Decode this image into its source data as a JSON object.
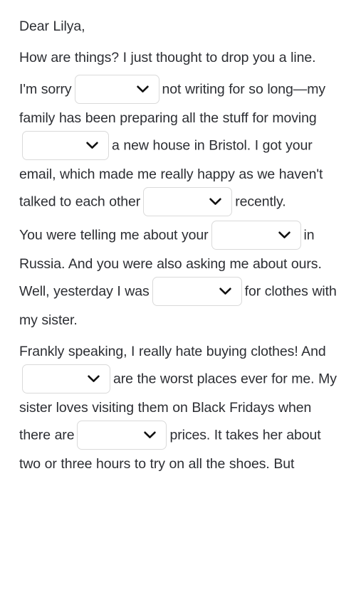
{
  "document": {
    "type": "fill-in-the-blank-letter",
    "background_color": "#ffffff",
    "text_color": "#2c2e33",
    "dropdown_border_color": "#dadada",
    "paragraphs": [
      {
        "id": "greeting",
        "segments": [
          {
            "kind": "text",
            "value": "Dear Lilya,"
          }
        ]
      },
      {
        "id": "opening",
        "segments": [
          {
            "kind": "text",
            "value": "How are things? I just thought to drop you a line."
          }
        ]
      },
      {
        "id": "apology",
        "segments": [
          {
            "kind": "text",
            "value": "I'm sorry"
          },
          {
            "kind": "dropdown",
            "id": "gap-1",
            "value": "",
            "icon": "chevron-down-icon"
          },
          {
            "kind": "text",
            "value": "not writing for so long—my family has been preparing all the stuff for moving"
          },
          {
            "kind": "dropdown",
            "id": "gap-2",
            "value": "",
            "icon": "chevron-down-icon"
          },
          {
            "kind": "text",
            "value": "a new house in Bristol. I got your email, which made me really happy as we haven't talked to each other"
          },
          {
            "kind": "dropdown",
            "id": "gap-3",
            "value": "",
            "icon": "chevron-down-icon"
          },
          {
            "kind": "text",
            "value": "recently."
          }
        ]
      },
      {
        "id": "shopping",
        "segments": [
          {
            "kind": "text",
            "value": "You were telling me about your"
          },
          {
            "kind": "dropdown",
            "id": "gap-4",
            "value": "",
            "icon": "chevron-down-icon"
          },
          {
            "kind": "text",
            "value": "in Russia. And you were also asking me about ours. Well, yesterday I was"
          },
          {
            "kind": "dropdown",
            "id": "gap-5",
            "value": "",
            "icon": "chevron-down-icon"
          },
          {
            "kind": "text",
            "value": "for clothes with my sister."
          }
        ]
      },
      {
        "id": "opinion",
        "segments": [
          {
            "kind": "text",
            "value": "Frankly speaking, I really hate buying clothes! And"
          },
          {
            "kind": "dropdown",
            "id": "gap-6",
            "value": "",
            "icon": "chevron-down-icon"
          },
          {
            "kind": "text",
            "value": "are the worst places ever for me. My sister loves visiting them on Black Fridays when there are"
          },
          {
            "kind": "dropdown",
            "id": "gap-7",
            "value": "",
            "icon": "chevron-down-icon"
          },
          {
            "kind": "text",
            "value": "prices. It takes her about two or three hours to try on all the shoes. But"
          }
        ]
      }
    ],
    "text": {
      "greeting": "Dear Lilya,",
      "opening": "How are things? I just thought to drop you a line.",
      "apology_1": "I'm sorry",
      "apology_2": "not writing for so long—my family has been preparing all the stuff for moving",
      "apology_3": "a new house in Bristol. I got your email, which made me really happy as we haven't talked to each other",
      "apology_4": "recently.",
      "shopping_1": "You were telling me about your",
      "shopping_2": "in Russia. And you were also asking me about ours. Well, yesterday I was",
      "shopping_3": "for clothes with my sister.",
      "opinion_1": "Frankly speaking, I really hate buying clothes! And",
      "opinion_2": "are the worst places ever for me. My sister loves visiting them on Black Fridays when there are",
      "opinion_3": "prices. It takes her about two or three hours to try on all the shoes. But"
    },
    "dropdowns": [
      {
        "id": "gap-1",
        "value": "",
        "icon": "chevron-down-icon"
      },
      {
        "id": "gap-2",
        "value": "",
        "icon": "chevron-down-icon"
      },
      {
        "id": "gap-3",
        "value": "",
        "icon": "chevron-down-icon"
      },
      {
        "id": "gap-4",
        "value": "",
        "icon": "chevron-down-icon"
      },
      {
        "id": "gap-5",
        "value": "",
        "icon": "chevron-down-icon"
      },
      {
        "id": "gap-6",
        "value": "",
        "icon": "chevron-down-icon"
      },
      {
        "id": "gap-7",
        "value": "",
        "icon": "chevron-down-icon"
      }
    ]
  }
}
